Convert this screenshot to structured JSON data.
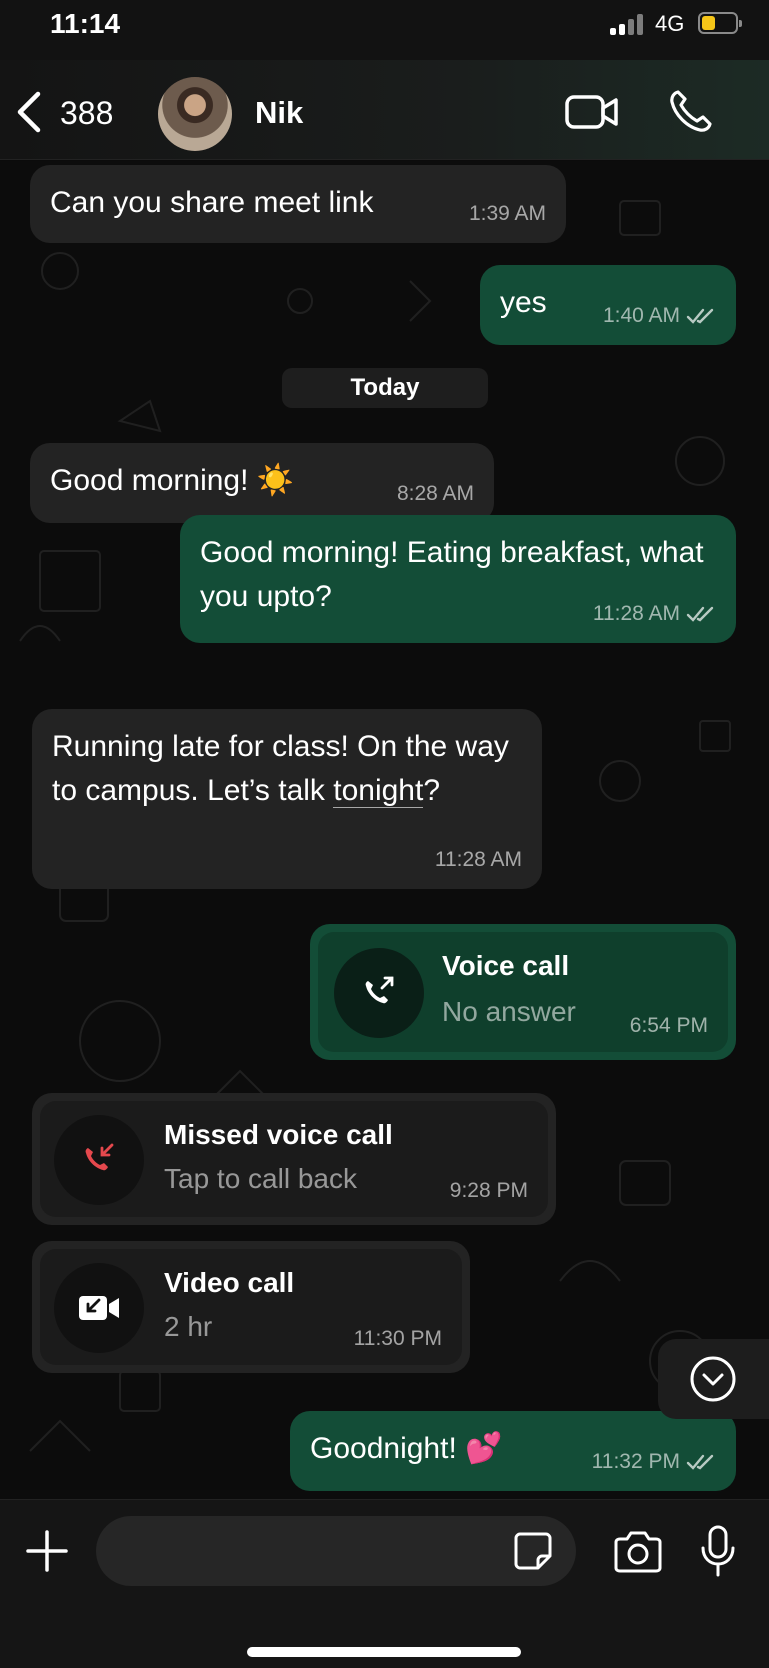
{
  "status_bar": {
    "time": "11:14",
    "network": "4G",
    "battery_color": "#f5c518"
  },
  "header": {
    "back_count": "388",
    "contact_name": "Nik",
    "video_icon": "video-camera-icon",
    "call_icon": "phone-icon"
  },
  "messages": [
    {
      "dir": "in",
      "text": "Can you share meet link",
      "time": "1:39 AM"
    },
    {
      "dir": "out",
      "text": "yes",
      "time": "1:40 AM",
      "read": true
    },
    {
      "dir": "in",
      "text": "Good morning! ☀️",
      "time": "8:28 AM"
    },
    {
      "dir": "out",
      "text": "Good morning! Eating breakfast, what you upto?",
      "time": "11:28 AM",
      "read": true
    },
    {
      "dir": "in",
      "text_before": "Running late for class! On the way to campus. Let’s talk ",
      "text_link": "tonight",
      "text_after": "?",
      "time": "11:28 AM"
    },
    {
      "dir": "out",
      "text": "Goodnight! 💕",
      "time": "11:32 PM",
      "read": true
    }
  ],
  "day_separator": "Today",
  "calls": [
    {
      "dir": "out",
      "title": "Voice call",
      "subtitle": "No answer",
      "time": "6:54 PM",
      "icon": "outgoing-call-icon"
    },
    {
      "dir": "in",
      "title": "Missed voice call",
      "subtitle": "Tap to call back",
      "time": "9:28 PM",
      "icon": "missed-call-icon"
    },
    {
      "dir": "in",
      "title": "Video call",
      "subtitle": "2 hr",
      "time": "11:30 PM",
      "icon": "incoming-video-icon"
    }
  ],
  "composer": {
    "placeholder": ""
  },
  "colors": {
    "incoming_bubble": "#232323",
    "outgoing_bubble": "#134d37",
    "missed_call": "#e5484d"
  }
}
